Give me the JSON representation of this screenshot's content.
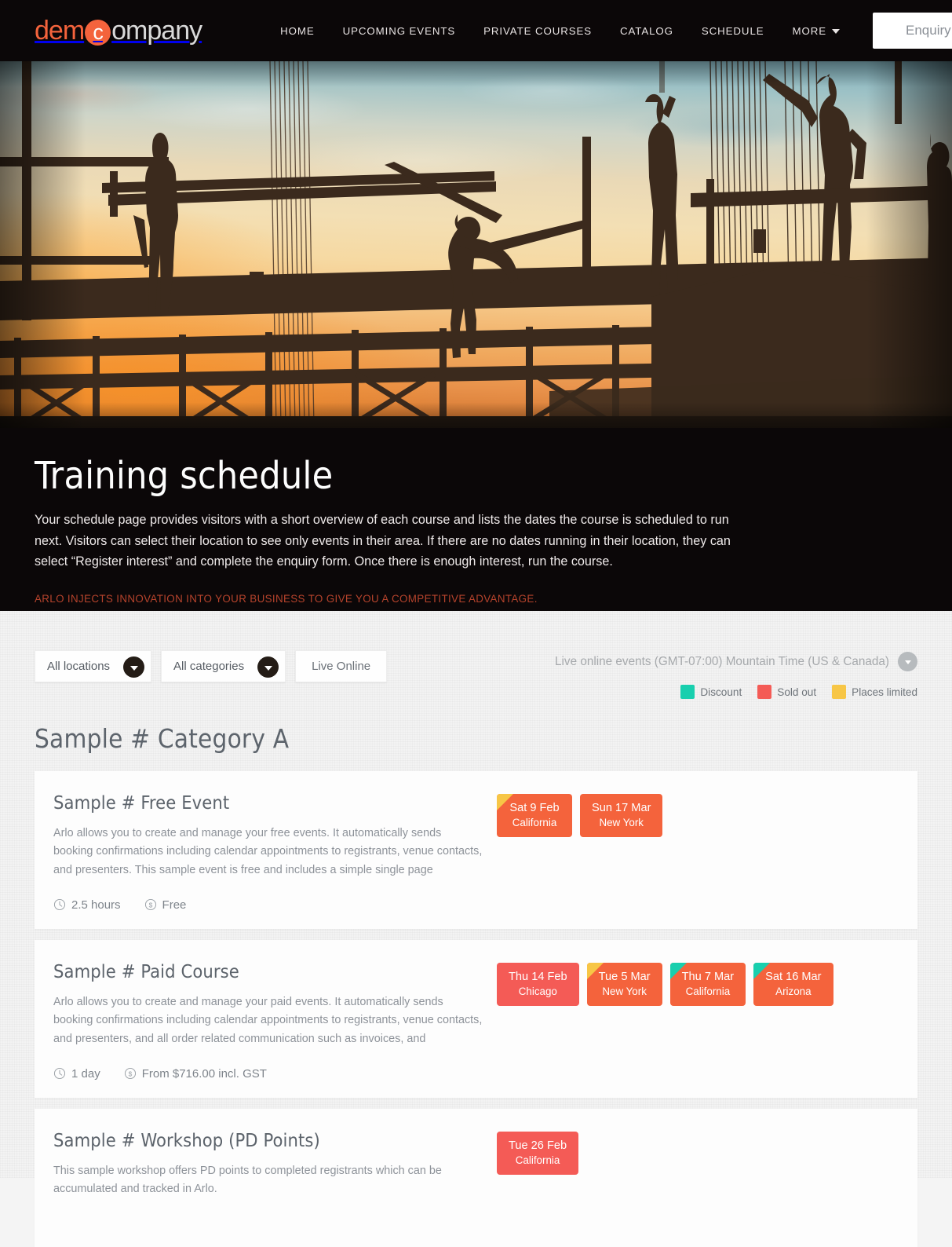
{
  "brand": {
    "logo_part1": "dem",
    "logo_circle": "c",
    "logo_part2": "ompany",
    "accent": "#f4633c"
  },
  "nav": {
    "items": [
      {
        "label": "HOME"
      },
      {
        "label": "UPCOMING EVENTS"
      },
      {
        "label": "PRIVATE COURSES"
      },
      {
        "label": "CATALOG"
      },
      {
        "label": "SCHEDULE"
      },
      {
        "label": "MORE"
      }
    ],
    "enquiry_label": "Enquiry",
    "search_icon": "search-icon",
    "cart_icon": "cart-icon",
    "more_chevron_icon": "chevron-down-icon"
  },
  "hero": {
    "image_alt": "construction workers silhouetted on scaffolding at sunset",
    "title": "Training schedule",
    "lead": "Your schedule page provides visitors with a short overview of each course and lists the dates the course is scheduled to run next. Visitors can select their location to see only events in their area. If there are no dates running in their location, they can select “Register interest” and complete the enquiry form. Once there is enough interest, run the course.",
    "tagline": "ARLO INJECTS INNOVATION INTO YOUR BUSINESS TO GIVE YOU A COMPETITIVE ADVANTAGE."
  },
  "filters": {
    "location_select": "All locations",
    "category_select": "All categories",
    "live_online_label": "Live Online",
    "timezone_label": "Live online events (GMT-07:00) Mountain Time (US & Canada)",
    "legend": [
      {
        "label": "Discount",
        "color": "#18cfae"
      },
      {
        "label": "Sold out",
        "color": "#f45b56"
      },
      {
        "label": "Places limited",
        "color": "#f7c646"
      }
    ]
  },
  "category": {
    "title": "Sample # Category A"
  },
  "events": [
    {
      "title": "Sample # Free Event",
      "description": "Arlo allows you to create and manage your free events. It automatically sends booking confirmations including calendar appointments to registrants, venue contacts, and presenters. This sample event is free and includes a simple single page",
      "duration": "2.5 hours",
      "price": "Free",
      "dates": [
        {
          "date": "Sat 9 Feb",
          "location": "California",
          "bg": "#f4633c",
          "corner": "#f7c646"
        },
        {
          "date": "Sun 17 Mar",
          "location": "New York",
          "bg": "#f4633c",
          "corner": ""
        }
      ]
    },
    {
      "title": "Sample # Paid Course",
      "description": "Arlo allows you to create and manage your paid events. It automatically sends booking confirmations including calendar appointments to registrants, venue contacts, and presenters, and all order related communication such as invoices, and",
      "duration": "1 day",
      "price": "From $716.00 incl. GST",
      "dates": [
        {
          "date": "Thu 14 Feb",
          "location": "Chicago",
          "bg": "#f45b56",
          "corner": ""
        },
        {
          "date": "Tue 5 Mar",
          "location": "New York",
          "bg": "#f4633c",
          "corner": "#f7c646"
        },
        {
          "date": "Thu 7 Mar",
          "location": "California",
          "bg": "#f4633c",
          "corner": "#18cfae"
        },
        {
          "date": "Sat 16 Mar",
          "location": "Arizona",
          "bg": "#f4633c",
          "corner": "#18cfae"
        }
      ]
    },
    {
      "title": "Sample # Workshop (PD Points)",
      "description": "This sample workshop offers PD points to completed registrants which can be accumulated and tracked in Arlo.",
      "duration": "",
      "price": "",
      "dates": [
        {
          "date": "Tue 26 Feb",
          "location": "California",
          "bg": "#f45b56",
          "corner": ""
        }
      ]
    }
  ]
}
